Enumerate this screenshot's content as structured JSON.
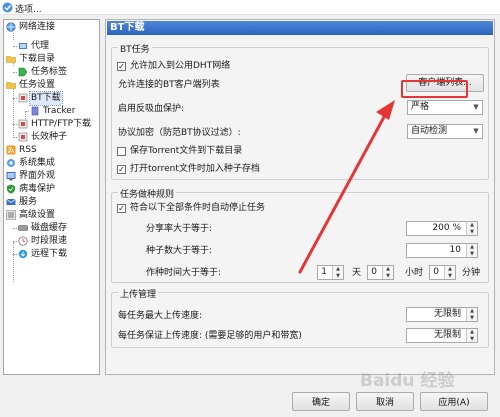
{
  "window": {
    "title": "选项..."
  },
  "tree": {
    "items": [
      {
        "label": "网络连接",
        "icon": "network-icon"
      },
      {
        "label": "代理",
        "icon": "proxy-icon"
      },
      {
        "label": "下载目录",
        "icon": "folder-icon"
      },
      {
        "label": "任务标签",
        "icon": "tag-icon"
      },
      {
        "label": "任务设置",
        "icon": "task-settings-icon"
      },
      {
        "label": "BT下载",
        "icon": "bt-icon"
      },
      {
        "label": "Tracker",
        "icon": "tracker-icon"
      },
      {
        "label": "HTTP/FTP下载",
        "icon": "http-ftp-icon"
      },
      {
        "label": "长效种子",
        "icon": "seed-icon"
      },
      {
        "label": "RSS",
        "icon": "rss-icon"
      },
      {
        "label": "系统集成",
        "icon": "system-integration-icon"
      },
      {
        "label": "界面外观",
        "icon": "appearance-icon"
      },
      {
        "label": "病毒保护",
        "icon": "shield-icon"
      },
      {
        "label": "服务",
        "icon": "service-icon"
      },
      {
        "label": "高级设置",
        "icon": "advanced-settings-icon"
      },
      {
        "label": "磁盘缓存",
        "icon": "disk-cache-icon"
      },
      {
        "label": "时段限速",
        "icon": "speed-limit-icon"
      },
      {
        "label": "远程下载",
        "icon": "remote-download-icon"
      }
    ],
    "selected": "BT下载"
  },
  "panel": {
    "title": "BT下载",
    "bt_task": {
      "group_title": "BT任务",
      "dht_label": "允许加入到公用DHT网络",
      "dht_checked": true,
      "allowed_clients_label": "允许连接的BT客户端列表",
      "client_list_button": "客户端列表...",
      "anti_leech_label": "启用反吸血保护:",
      "anti_leech_value": "严格",
      "encryption_label": "协议加密（防范BT协议过滤）:",
      "encryption_value": "自动检测",
      "save_torrent_label": "保存Torrent文件到下载目录",
      "save_torrent_checked": false,
      "open_torrent_label": "打开torrent文件时加入种子存档",
      "open_torrent_checked": true
    },
    "seeding": {
      "group_title": "任务做种规则",
      "auto_stop_label": "符合以下全部条件时自动停止任务",
      "auto_stop_checked": true,
      "ratio_label": "分享率大于等于:",
      "ratio_value": "200 %",
      "seeds_label": "种子数大于等于:",
      "seeds_value": "10",
      "time_label": "作种时间大于等于:",
      "days_value": "1",
      "days_unit": "天",
      "hours_value": "0",
      "hours_unit": "小时",
      "minutes_value": "0",
      "minutes_unit": "分钟"
    },
    "upload": {
      "group_title": "上传管理",
      "max_upload_label": "每任务最大上传速度:",
      "max_upload_value": "无限制",
      "guarantee_label": "每任务保证上传速度: (需要足够的用户和带宽)",
      "guarantee_value": "无限制"
    }
  },
  "footer": {
    "ok": "确定",
    "cancel": "取消",
    "apply": "应用(A)"
  },
  "watermark": "Baidu 经验",
  "colors": {
    "header_blue": "#3a72cc",
    "annotation_red": "#e53535"
  }
}
